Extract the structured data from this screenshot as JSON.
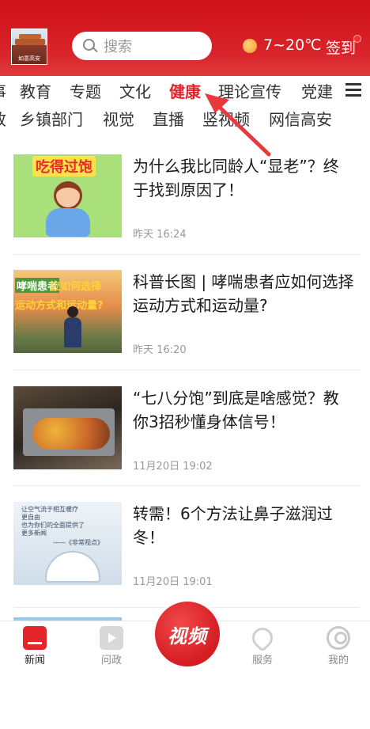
{
  "header": {
    "logo_text": "如意高安",
    "search_placeholder": "搜索",
    "temperature": "7~20℃",
    "signin_label": "签到"
  },
  "tabs_row1": [
    "事",
    "教育",
    "专题",
    "文化",
    "健康",
    "理论宣传",
    "党建"
  ],
  "tabs_row2": [
    "政",
    "乡镇部门",
    "视觉",
    "直播",
    "竖视频",
    "网信高安"
  ],
  "active_tab": "健康",
  "news": [
    {
      "title": "为什么我比同龄人“显老”？终于找到原因了！",
      "time": "昨天 16:24",
      "thumb_caption": "吃得过饱"
    },
    {
      "title": "科普长图 | 哮喘患者应如何选择运动方式和运动量?",
      "time": "昨天 16:20",
      "thumb_caption_a": "哮喘患者",
      "thumb_caption_b": "应如何选择",
      "thumb_caption_c": "运动方式和运动量?"
    },
    {
      "title": "“七八分饱”到底是啥感觉？教你3招秒懂身体信号！",
      "time": "11月20日 19:02"
    },
    {
      "title": "转需！6个方法让鼻子滋润过冬！",
      "time": "11月20日 19:01",
      "thumb_lines": [
        "让空气流于相互暖疗",
        "更自由",
        "也为你们的全面提供了",
        "更多新闻",
        "——《非常视点》"
      ]
    }
  ],
  "bottom_nav": {
    "news": "新闻",
    "wenzheng": "问政",
    "video": "视频",
    "fuwu": "服务",
    "mine": "我的"
  },
  "colors": {
    "brand_red": "#d51c22",
    "active_tab": "#e0262b",
    "arrow": "#e8393c"
  }
}
